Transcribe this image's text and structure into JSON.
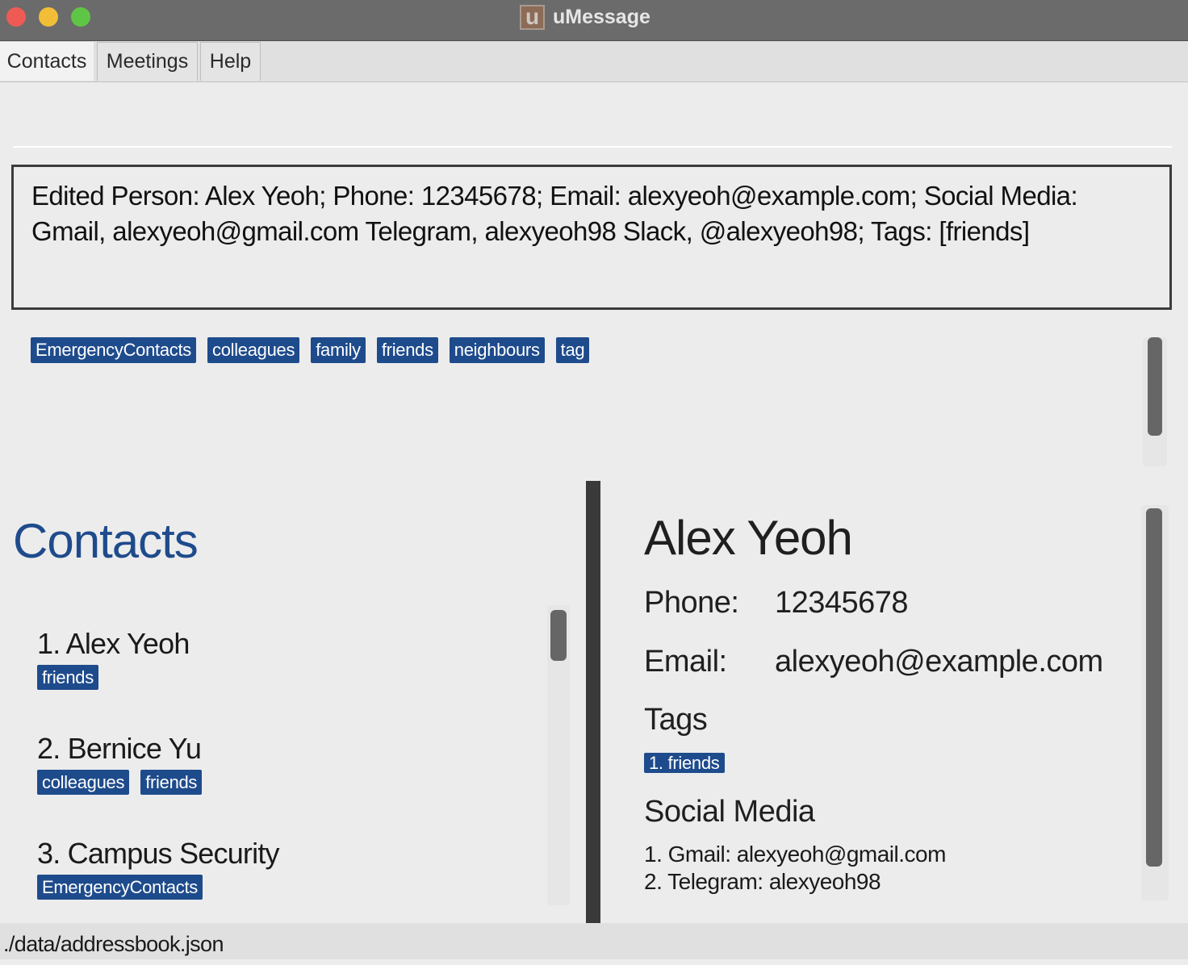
{
  "window": {
    "title": "uMessage",
    "icon_letter": "u"
  },
  "menu": {
    "tabs": [
      "Contacts",
      "Meetings",
      "Help"
    ]
  },
  "command": {
    "input_value": "",
    "result": "Edited Person: Alex Yeoh; Phone: 12345678; Email: alexyeoh@example.com; Social Media: Gmail, alexyeoh@gmail.com Telegram, alexyeoh98 Slack, @alexyeoh98; Tags: [friends]"
  },
  "tag_filter": [
    "EmergencyContacts",
    "colleagues",
    "family",
    "friends",
    "neighbours",
    "tag"
  ],
  "contacts": {
    "heading": "Contacts",
    "items": [
      {
        "name": "1.  Alex Yeoh",
        "tags": [
          "friends"
        ]
      },
      {
        "name": "2.  Bernice Yu",
        "tags": [
          "colleagues",
          "friends"
        ]
      },
      {
        "name": "3.  Campus Security",
        "tags": [
          "EmergencyContacts"
        ]
      }
    ]
  },
  "details": {
    "name": "Alex Yeoh",
    "phone_label": "Phone:",
    "phone": "12345678",
    "email_label": "Email:",
    "email": "alexyeoh@example.com",
    "tags_label": "Tags",
    "tags": [
      "1. friends"
    ],
    "social_label": "Social Media",
    "social": [
      "1. Gmail: alexyeoh@gmail.com",
      "2. Telegram: alexyeoh98"
    ]
  },
  "status": {
    "path": "./data/addressbook.json"
  },
  "colors": {
    "accent": "#1e4b8c",
    "titlebar": "#6b6b6b",
    "background": "#ececec"
  }
}
